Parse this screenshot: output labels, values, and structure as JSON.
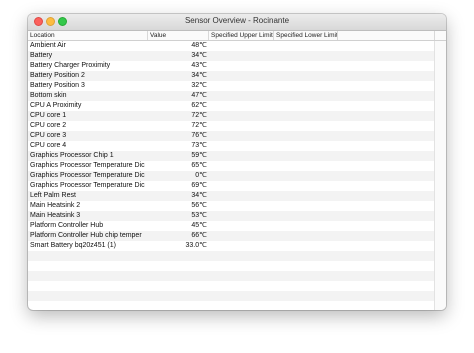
{
  "window": {
    "title": "Sensor Overview - Rocinante"
  },
  "table": {
    "headers": [
      "Location",
      "Value",
      "Specified Upper Limit",
      "Specified Lower Limit"
    ],
    "rows": [
      {
        "location": "Ambient Air",
        "value": "48℃"
      },
      {
        "location": "Battery",
        "value": "34℃"
      },
      {
        "location": "Battery Charger Proximity",
        "value": "43℃"
      },
      {
        "location": "Battery Position 2",
        "value": "34℃"
      },
      {
        "location": "Battery Position 3",
        "value": "32℃"
      },
      {
        "location": "Bottom skin",
        "value": "47℃"
      },
      {
        "location": "CPU A Proximity",
        "value": "62℃"
      },
      {
        "location": "CPU core 1",
        "value": "72℃"
      },
      {
        "location": "CPU core 2",
        "value": "72℃"
      },
      {
        "location": "CPU core 3",
        "value": "76℃"
      },
      {
        "location": "CPU core 4",
        "value": "73℃"
      },
      {
        "location": "Graphics Processor Chip 1",
        "value": "59℃"
      },
      {
        "location": "Graphics Processor Temperature Dic",
        "value": "65℃"
      },
      {
        "location": "Graphics Processor Temperature Dic",
        "value": "0℃"
      },
      {
        "location": "Graphics Processor Temperature Dic",
        "value": "69℃"
      },
      {
        "location": "Left Palm Rest",
        "value": "34℃"
      },
      {
        "location": "Main Heatsink 2",
        "value": "56℃"
      },
      {
        "location": "Main Heatsink 3",
        "value": "53℃"
      },
      {
        "location": "Platform Controller Hub",
        "value": "45℃"
      },
      {
        "location": "Platform Controller Hub chip temper",
        "value": "66℃"
      },
      {
        "location": "Smart Battery bq20z451 (1)",
        "value": "33.0℃"
      }
    ],
    "empty_rows": 6
  }
}
